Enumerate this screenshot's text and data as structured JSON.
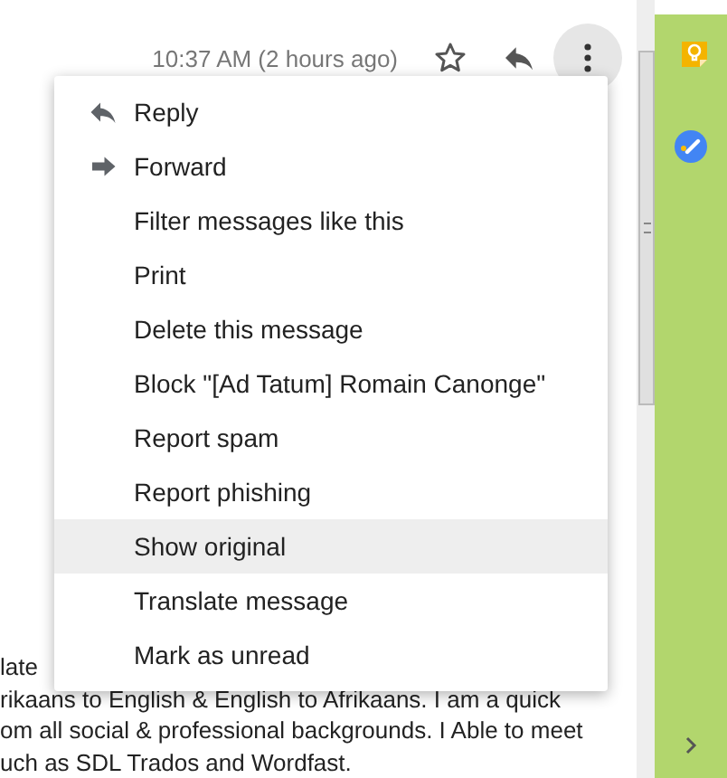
{
  "header": {
    "time": "10:37 AM (2 hours ago)"
  },
  "menu": {
    "items": [
      {
        "label": "Reply",
        "kind": "reply",
        "selected": false
      },
      {
        "label": "Forward",
        "kind": "forward",
        "selected": false
      },
      {
        "label": "Filter messages like this",
        "kind": "plain",
        "selected": false
      },
      {
        "label": "Print",
        "kind": "plain",
        "selected": false
      },
      {
        "label": "Delete this message",
        "kind": "plain",
        "selected": false
      },
      {
        "label": "Block \"[Ad Tatum] Romain Canonge\"",
        "kind": "plain",
        "selected": false
      },
      {
        "label": "Report spam",
        "kind": "plain",
        "selected": false
      },
      {
        "label": "Report phishing",
        "kind": "plain",
        "selected": false
      },
      {
        "label": "Show original",
        "kind": "plain",
        "selected": true
      },
      {
        "label": "Translate message",
        "kind": "plain",
        "selected": false
      },
      {
        "label": "Mark as unread",
        "kind": "plain",
        "selected": false
      }
    ]
  },
  "message_body": {
    "lines": [
      "late",
      "rikaans to English & English to Afrikaans. I am a quick",
      "om all social & professional backgrounds. I Able to meet",
      "uch as SDL Trados and Wordfast."
    ]
  }
}
